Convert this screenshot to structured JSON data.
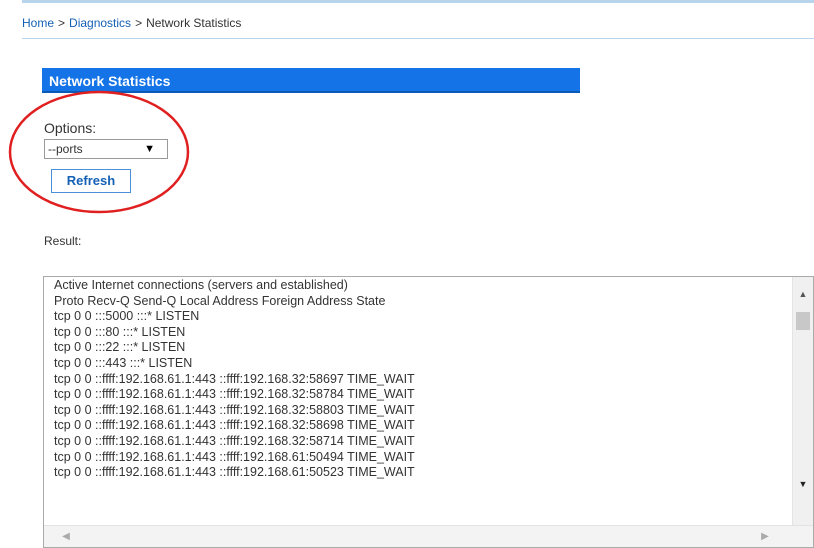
{
  "breadcrumb": {
    "home": "Home",
    "diagnostics": "Diagnostics",
    "current": "Network Statistics",
    "separator": ">"
  },
  "section": {
    "title": "Network Statistics"
  },
  "options": {
    "label": "Options:",
    "selected": "--ports",
    "arrow": "▼"
  },
  "refresh_label": "Refresh",
  "result": {
    "label": "Result:",
    "lines": [
      "Active Internet connections (servers and established)",
      "Proto Recv-Q Send-Q Local Address Foreign Address State",
      "tcp 0 0 :::5000 :::* LISTEN",
      "tcp 0 0 :::80 :::* LISTEN",
      "tcp 0 0 :::22 :::* LISTEN",
      "tcp 0 0 :::443 :::* LISTEN",
      "tcp 0 0 ::ffff:192.168.61.1:443 ::ffff:192.168.32:58697 TIME_WAIT",
      "tcp 0 0 ::ffff:192.168.61.1:443 ::ffff:192.168.32:58784 TIME_WAIT",
      "tcp 0 0 ::ffff:192.168.61.1:443 ::ffff:192.168.32:58803 TIME_WAIT",
      "tcp 0 0 ::ffff:192.168.61.1:443 ::ffff:192.168.32:58698 TIME_WAIT",
      "tcp 0 0 ::ffff:192.168.61.1:443 ::ffff:192.168.32:58714 TIME_WAIT",
      "tcp 0 0 ::ffff:192.168.61.1:443 ::ffff:192.168.61:50494 TIME_WAIT",
      "tcp 0 0 ::ffff:192.168.61.1:443 ::ffff:192.168.61:50523 TIME_WAIT"
    ]
  },
  "colors": {
    "header_bg": "#1473e6",
    "link": "#1560b5",
    "highlight_ring": "#e02020"
  },
  "icons": {
    "scroll_up": "▲",
    "scroll_down": "▼",
    "scroll_left": "◀",
    "scroll_right": "▶"
  }
}
